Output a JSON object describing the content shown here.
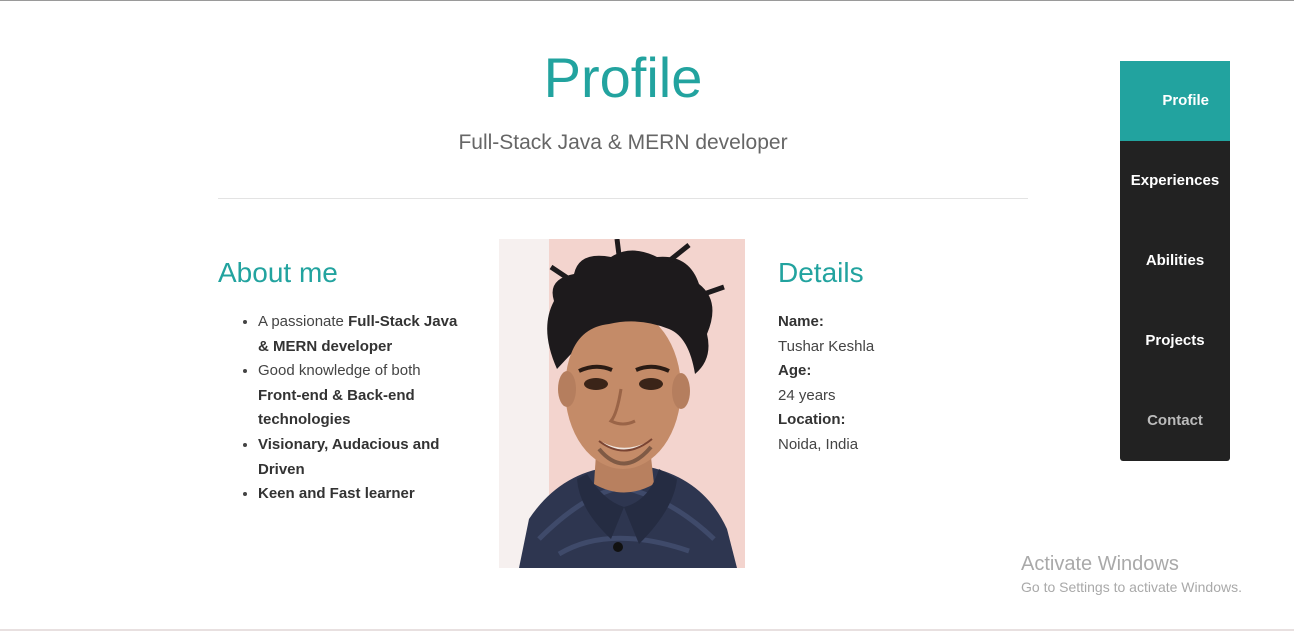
{
  "header": {
    "title": "Profile",
    "subtitle": "Full-Stack Java & MERN developer"
  },
  "about": {
    "heading": "About me",
    "items": [
      {
        "prefix": "A passionate ",
        "bold": "Full-Stack Java & MERN developer"
      },
      {
        "prefix": "Good knowledge of both ",
        "bold": "Front-end & Back-end technologies"
      },
      {
        "prefix": "",
        "bold": "Visionary, Audacious and Driven"
      },
      {
        "prefix": "",
        "bold": "Keen and Fast learner"
      }
    ]
  },
  "details": {
    "heading": "Details",
    "name_label": "Name:",
    "name_value": "Tushar Keshla",
    "age_label": "Age:",
    "age_value": "24 years",
    "location_label": "Location:",
    "location_value": "Noida, India"
  },
  "nav": {
    "items": [
      {
        "label": "Profile",
        "active": true
      },
      {
        "label": "Experiences",
        "active": false
      },
      {
        "label": "Abilities",
        "active": false
      },
      {
        "label": "Projects",
        "active": false
      },
      {
        "label": "Contact",
        "active": false
      }
    ]
  },
  "watermark": {
    "line1": "Activate Windows",
    "line2": "Go to Settings to activate Windows."
  },
  "colors": {
    "accent": "#22a39f",
    "nav_bg": "#222222"
  }
}
